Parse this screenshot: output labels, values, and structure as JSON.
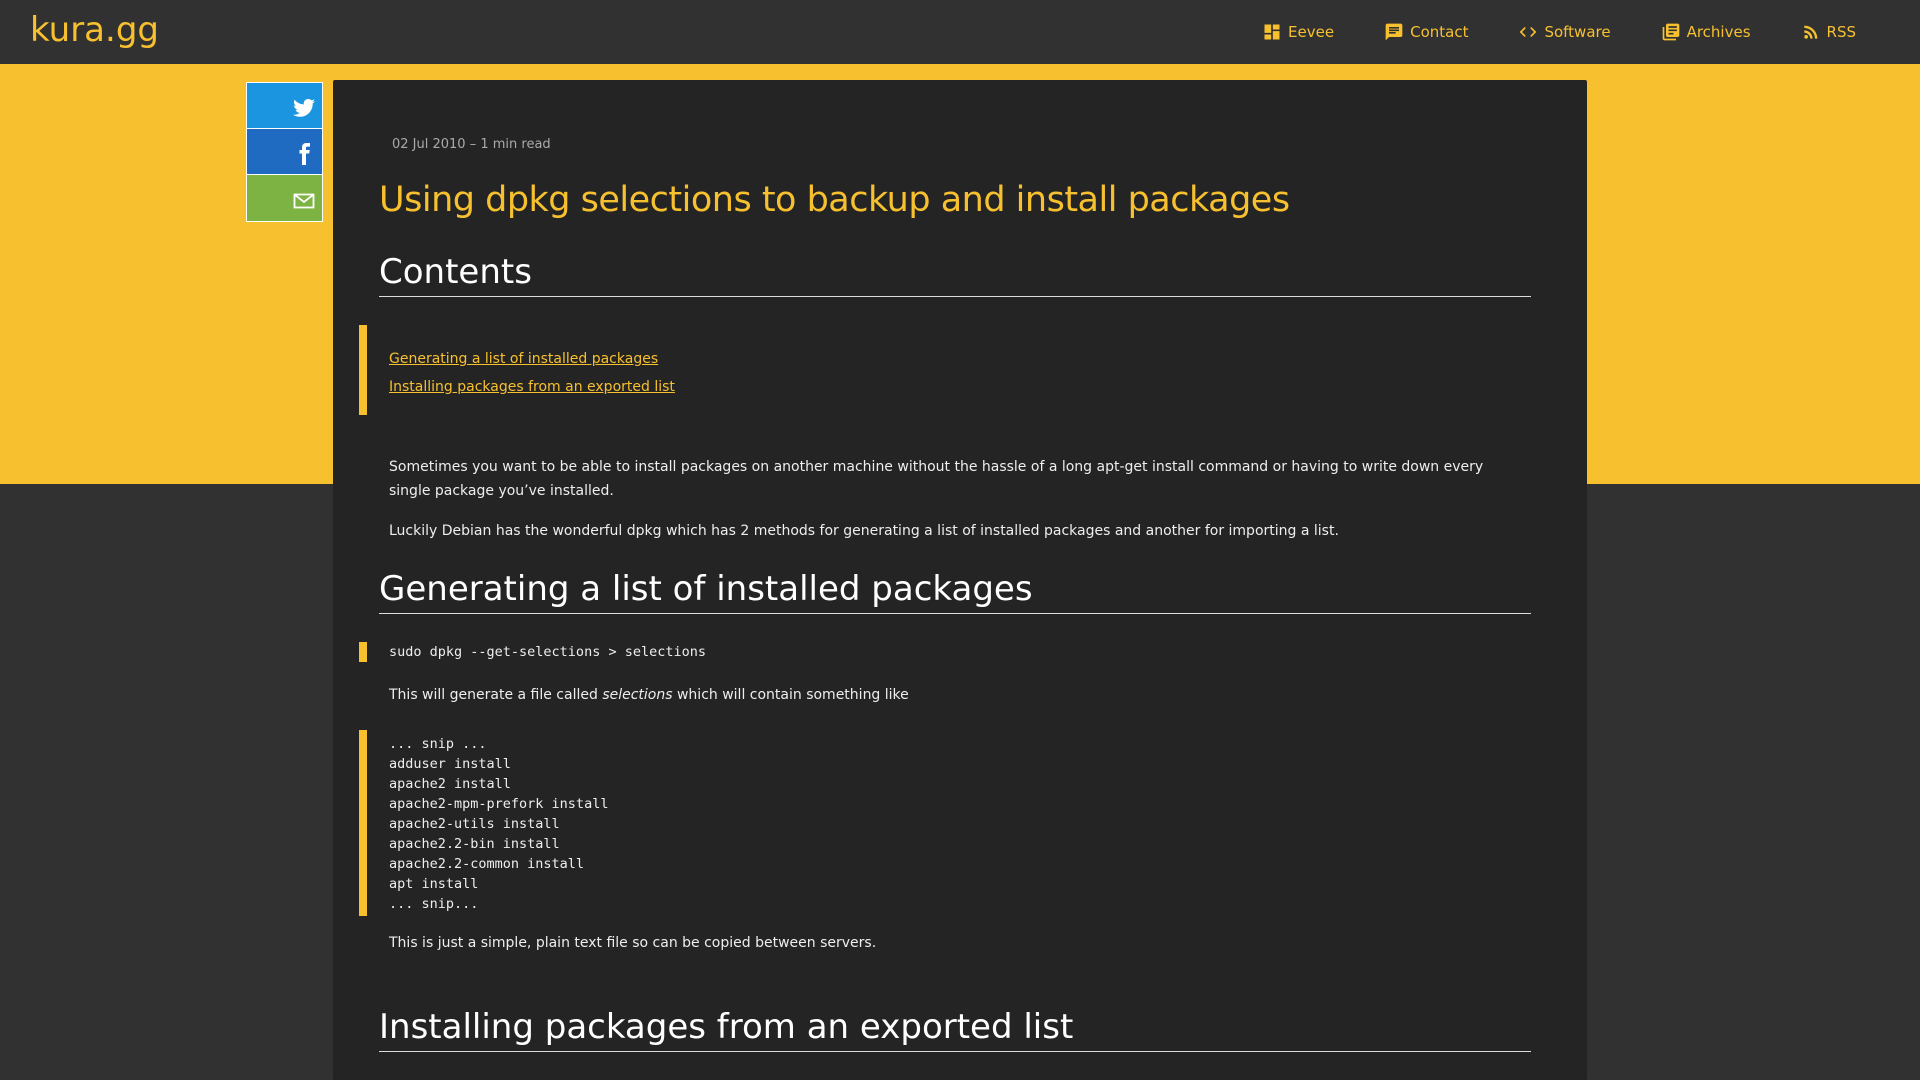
{
  "site": {
    "brand": "kura.gg"
  },
  "nav": {
    "items": [
      {
        "label": "Eevee",
        "icon": "dashboard-icon"
      },
      {
        "label": "Contact",
        "icon": "message-icon"
      },
      {
        "label": "Software",
        "icon": "code-icon"
      },
      {
        "label": "Archives",
        "icon": "library-icon"
      },
      {
        "label": "RSS",
        "icon": "rss-icon"
      }
    ]
  },
  "share": {
    "buttons": [
      {
        "name": "twitter",
        "icon": "twitter-icon",
        "color": "#1b95e0"
      },
      {
        "name": "facebook",
        "icon": "facebook-icon",
        "color": "#1f6bc1"
      },
      {
        "name": "email",
        "icon": "mail-icon",
        "color": "#7cb342"
      }
    ]
  },
  "article": {
    "meta": "02 Jul 2010 – 1 min read",
    "title": "Using dpkg selections to backup and install packages",
    "contents_heading": "Contents",
    "toc": [
      "Generating a list of installed packages",
      "Installing packages from an exported list"
    ],
    "intro_1": "Sometimes you want to be able to install packages on another machine without the hassle of a long apt-get install command or having to write down every single package you’ve installed.",
    "intro_2": "Luckily Debian has the wonderful dpkg which has 2 methods for generating a list of installed packages and another for importing a list.",
    "section_1_heading": "Generating a list of installed packages",
    "command_1": "sudo dpkg --get-selections > selections",
    "generate_text_before": "This will generate a file called ",
    "generate_text_em": "selections",
    "generate_text_after": " which will contain something like",
    "selections_lines": [
      "... snip ...",
      "adduser install",
      "apache2 install",
      "apache2-mpm-prefork install",
      "apache2-utils install",
      "apache2.2-bin install",
      "apache2.2-common install",
      "apt install",
      "... snip..."
    ],
    "plain_text_note": "This is just a simple, plain text file so can be copied between servers.",
    "section_2_heading": "Installing packages from an exported list"
  },
  "colors": {
    "accent": "#f7c02f",
    "background": "#313131",
    "article_bg": "#242424"
  }
}
